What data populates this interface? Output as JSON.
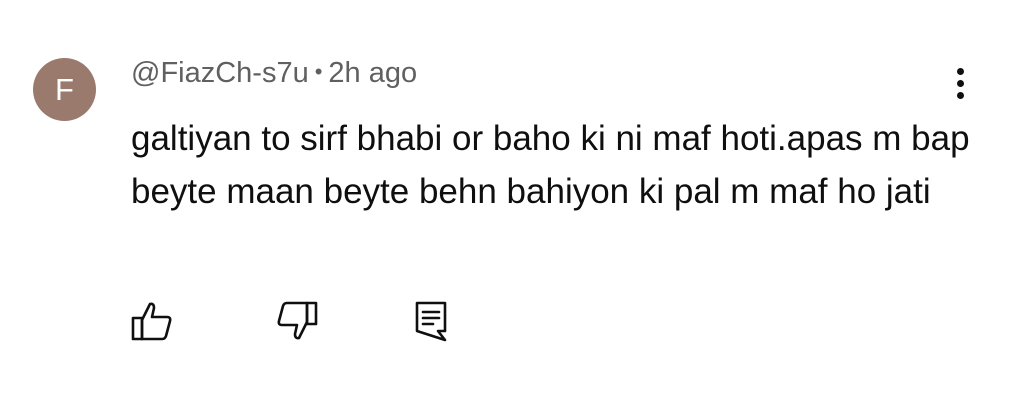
{
  "comment": {
    "avatar_letter": "F",
    "avatar_color": "#9a7a6c",
    "author": "@FiazCh-s7u",
    "separator": "•",
    "time": "2h ago",
    "text": "galtiyan to sirf bhabi or baho ki ni maf hoti.apas m bap beyte maan beyte behn bahiyon ki pal m maf ho jati"
  },
  "actions": {
    "like_icon": "thumbs-up-icon",
    "dislike_icon": "thumbs-down-icon",
    "reply_icon": "reply-comment-icon",
    "more_icon": "more-vertical-icon"
  }
}
